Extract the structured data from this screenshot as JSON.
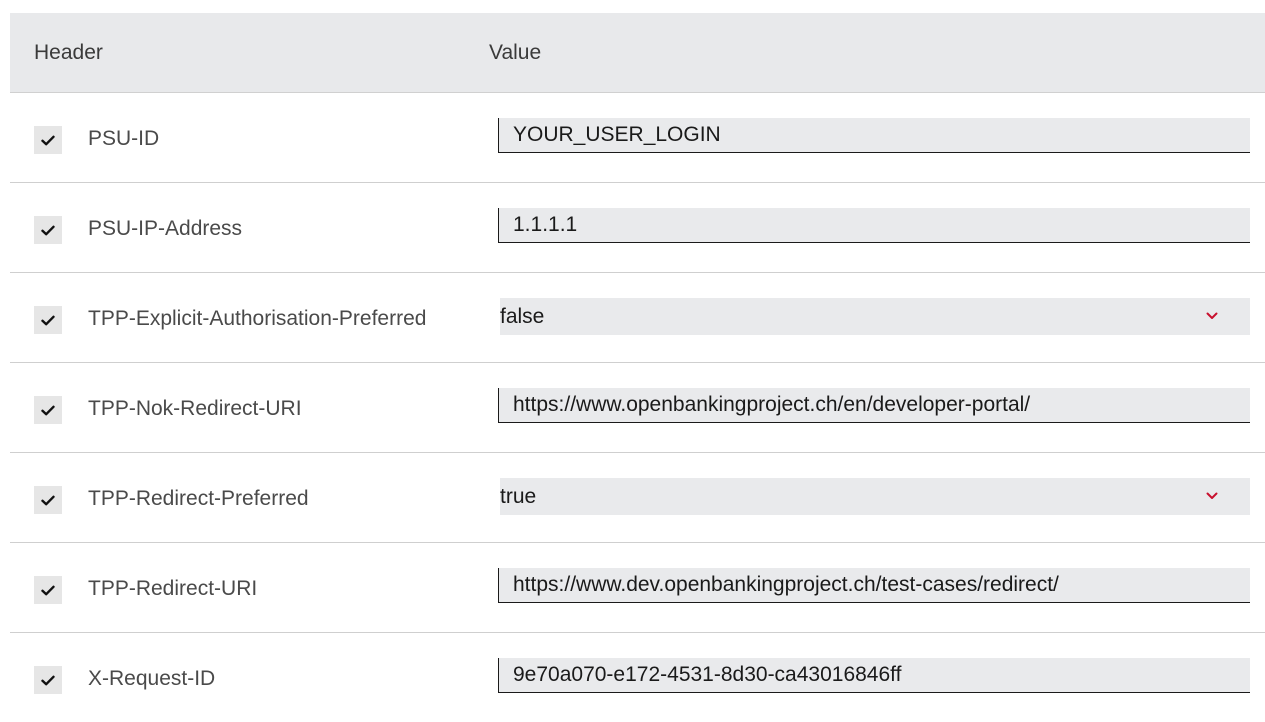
{
  "table": {
    "columns": {
      "header": "Header",
      "value": "Value"
    },
    "rows": [
      {
        "checked": true,
        "name": "PSU-ID",
        "kind": "input",
        "value": "YOUR_USER_LOGIN"
      },
      {
        "checked": true,
        "name": "PSU-IP-Address",
        "kind": "input",
        "value": "1.1.1.1"
      },
      {
        "checked": true,
        "name": "TPP-Explicit-Authorisation-Preferred",
        "kind": "select",
        "value": "false"
      },
      {
        "checked": true,
        "name": "TPP-Nok-Redirect-URI",
        "kind": "input",
        "value": "https://www.openbankingproject.ch/en/developer-portal/"
      },
      {
        "checked": true,
        "name": "TPP-Redirect-Preferred",
        "kind": "select",
        "value": "true"
      },
      {
        "checked": true,
        "name": "TPP-Redirect-URI",
        "kind": "input",
        "value": "https://www.dev.openbankingproject.ch/test-cases/redirect/"
      },
      {
        "checked": true,
        "name": "X-Request-ID",
        "kind": "input",
        "value": "9e70a070-e172-4531-8d30-ca43016846ff"
      }
    ]
  },
  "icons": {
    "checkbox": "checkmark-icon",
    "select": "chevron-down-icon"
  },
  "colors": {
    "header_bg": "#e8e9eb",
    "field_bg": "#e9eaec",
    "chevron": "#c8102e"
  }
}
